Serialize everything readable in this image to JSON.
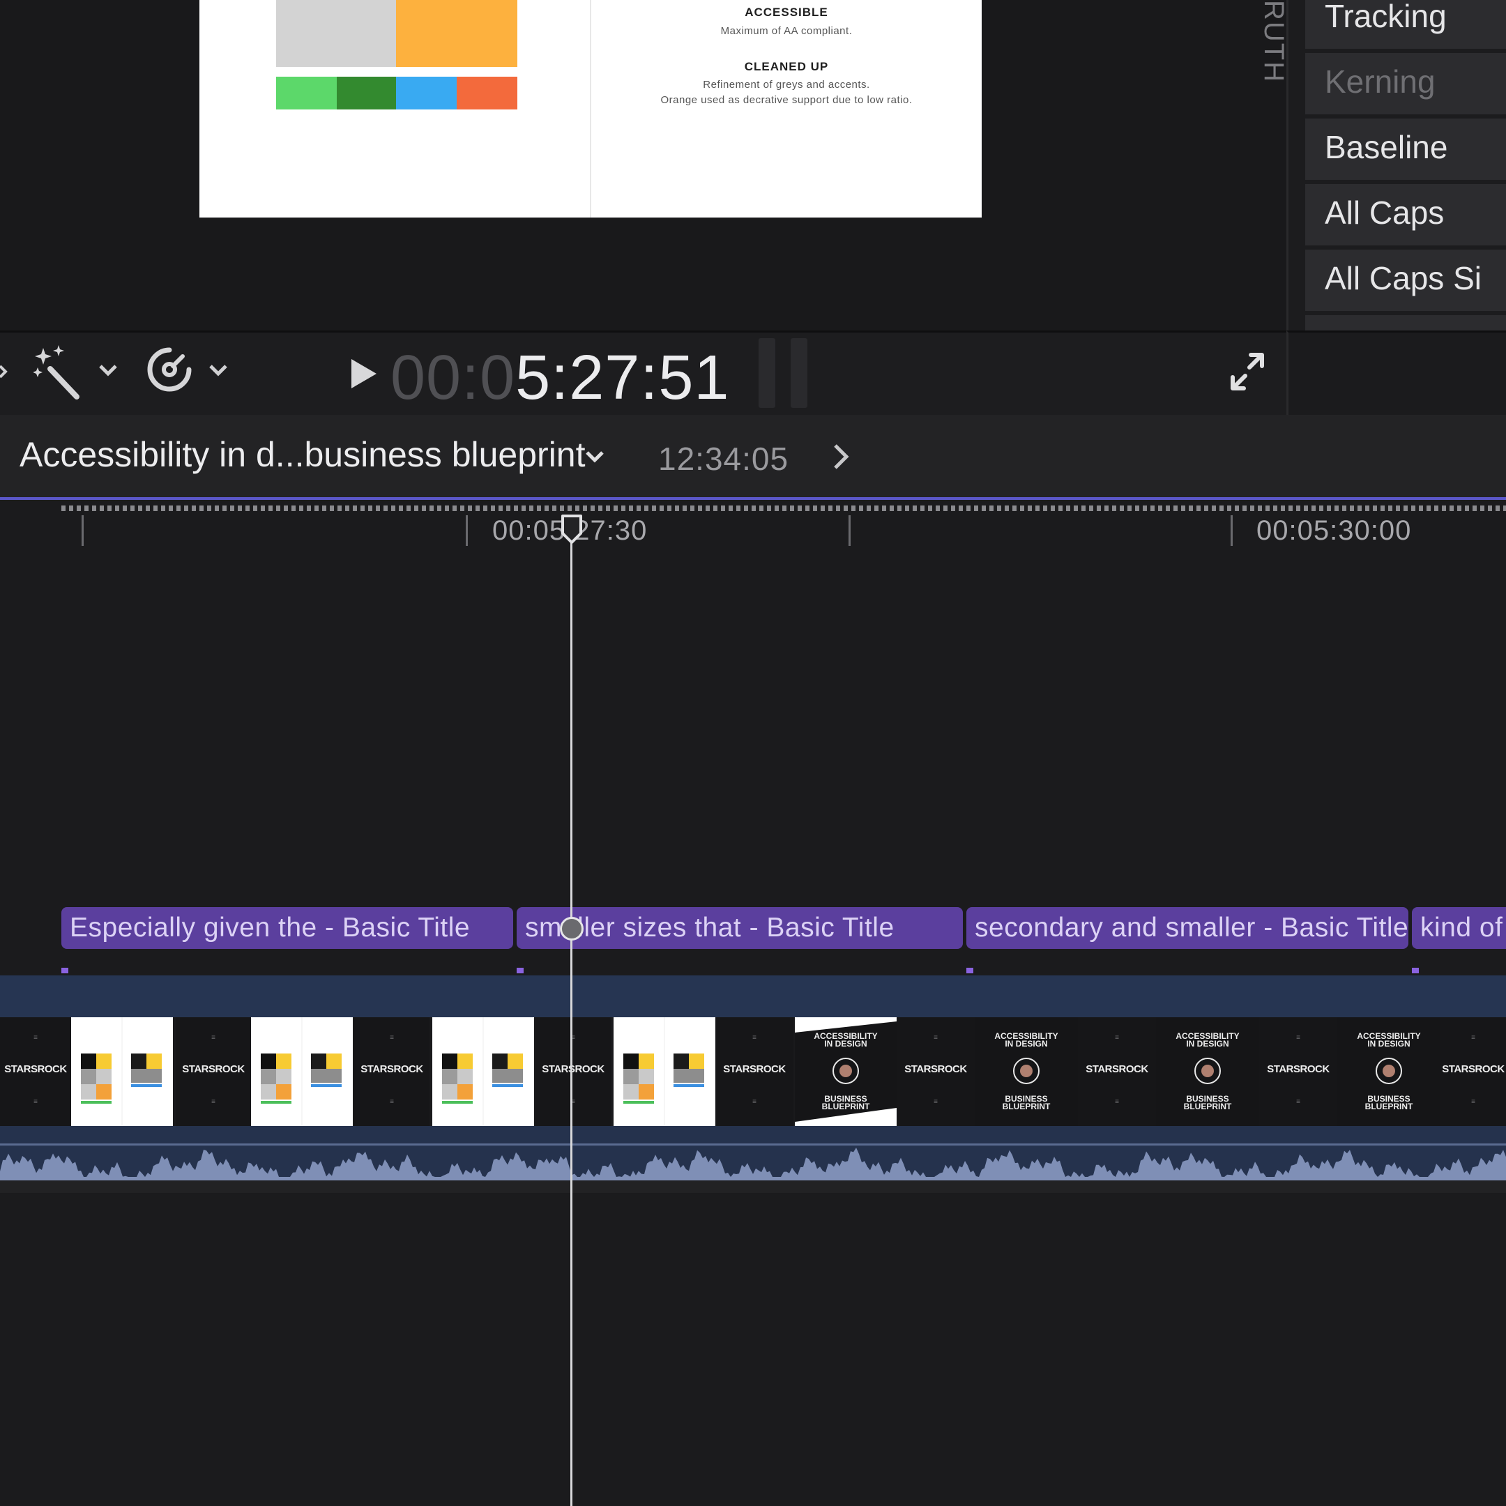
{
  "viewer": {
    "slide": {
      "heading_1": "ACCESSIBLE",
      "sub_1": "Maximum of AA compliant.",
      "heading_2": "CLEANED UP",
      "sub_2a": "Refinement of greys and accents.",
      "sub_2b": "Orange used as decrative support due to low ratio.",
      "swatch_colors": [
        "#d3d3d3",
        "#fdb13e",
        "#5cd86a",
        "#338a2f",
        "#39aaf2",
        "#f36a3c"
      ]
    },
    "side_text": "RUTH"
  },
  "inspector": {
    "items": [
      {
        "label": "Tracking",
        "enabled": true
      },
      {
        "label": "Kerning",
        "enabled": false
      },
      {
        "label": "Baseline",
        "enabled": true
      },
      {
        "label": "All Caps",
        "enabled": true
      },
      {
        "label": "All Caps Si",
        "enabled": true
      }
    ]
  },
  "transport": {
    "timecode_dim": "00:0",
    "timecode_bright": "5:27:51",
    "icons": [
      "magic-wand-icon",
      "speed-gauge-icon",
      "play-icon",
      "fullscreen-icon"
    ]
  },
  "timeline": {
    "project_title": "Accessibility in d...business blueprint",
    "project_duration": "12:34:05",
    "ruler_labels": [
      "00:05:27:30",
      "00:05:30:00"
    ],
    "titles": [
      "Especially given the - Basic Title",
      "smaller sizes that - Basic Title",
      "secondary and smaller - Basic Title",
      "kind of"
    ],
    "filmstrip": {
      "brand": "STARSROCK",
      "title_line_1": "ACCESSIBILITY",
      "title_line_2": "IN DESIGN",
      "title_line_3": "BUSINESS",
      "title_line_4": "BLUEPRINT"
    }
  },
  "colors": {
    "title_clip": "#5b3f9e",
    "video_band": "#263552",
    "audio_wave": "#7f8fb6",
    "accent": "#5b57c9"
  }
}
